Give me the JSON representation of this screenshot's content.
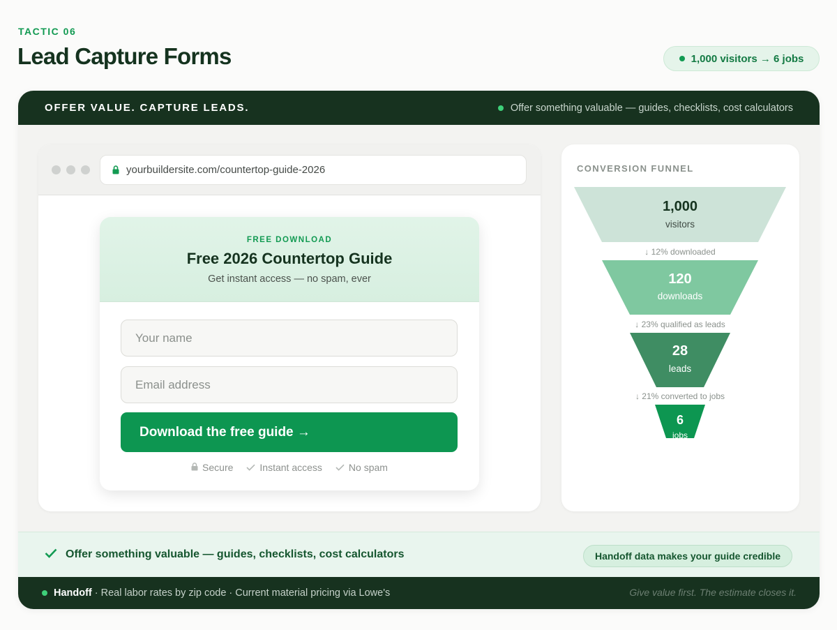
{
  "header": {
    "eyebrow": "TACTIC 06",
    "title": "Lead Capture Forms",
    "stat_pill": "1,000 visitors → 6 jobs"
  },
  "topbar": {
    "title": "OFFER VALUE. CAPTURE LEADS.",
    "note": "Offer something valuable — guides, checklists, cost calculators"
  },
  "browser": {
    "url": "yourbuildersite.com/countertop-guide-2026"
  },
  "form": {
    "eyebrow": "FREE DOWNLOAD",
    "title": "Free 2026 Countertop Guide",
    "subtitle": "Get instant access — no spam, ever",
    "name_placeholder": "Your name",
    "email_placeholder": "Email address",
    "cta_label": "Download the free guide →",
    "trust": [
      "Secure",
      "Instant access",
      "No spam"
    ]
  },
  "funnel": {
    "label": "CONVERSION FUNNEL",
    "stages": [
      {
        "value": "1,000",
        "label": "visitors",
        "color": "#cde3d8"
      },
      {
        "value": "120",
        "label": "downloads",
        "color": "#7fc8a0"
      },
      {
        "value": "28",
        "label": "leads",
        "color": "#3f8d63"
      },
      {
        "value": "6",
        "label": "jobs",
        "color": "#0d9651"
      }
    ],
    "transitions": [
      "↓ 12% downloaded",
      "↓ 23% qualified as leads",
      "↓ 21% converted to jobs"
    ]
  },
  "highlight": {
    "text": "Offer something valuable — guides, checklists, cost calculators",
    "pill": "Handoff data makes your guide credible"
  },
  "footer": {
    "strong": "Handoff",
    "text": " · Real labor rates by zip code · Current material pricing via Lowe's",
    "tagline": "Give value first. The estimate closes it."
  },
  "colors": {
    "brand_green": "#129a52",
    "dark_green": "#17321f",
    "cta_green": "#0d9651"
  }
}
